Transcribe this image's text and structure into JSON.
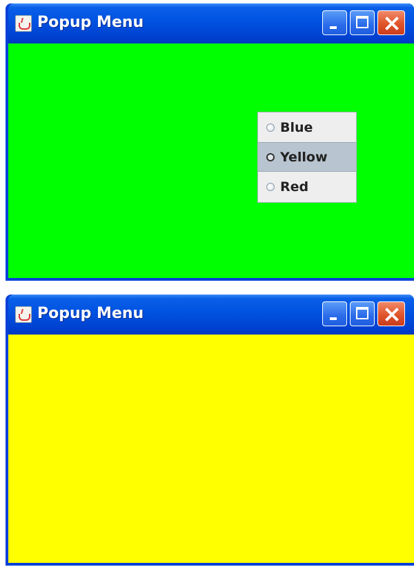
{
  "windows": [
    {
      "title": "Popup Menu",
      "background_color": "#00ff00",
      "popup_menu": {
        "items": [
          {
            "label": "Blue",
            "highlighted": false
          },
          {
            "label": "Yellow",
            "highlighted": true
          },
          {
            "label": "Red",
            "highlighted": false
          }
        ]
      }
    },
    {
      "title": "Popup Menu",
      "background_color": "#ffff00"
    }
  ],
  "icons": {
    "app": "java-coffee-cup-icon",
    "minimize": "minimize-icon",
    "maximize": "maximize-icon",
    "close": "close-icon"
  }
}
